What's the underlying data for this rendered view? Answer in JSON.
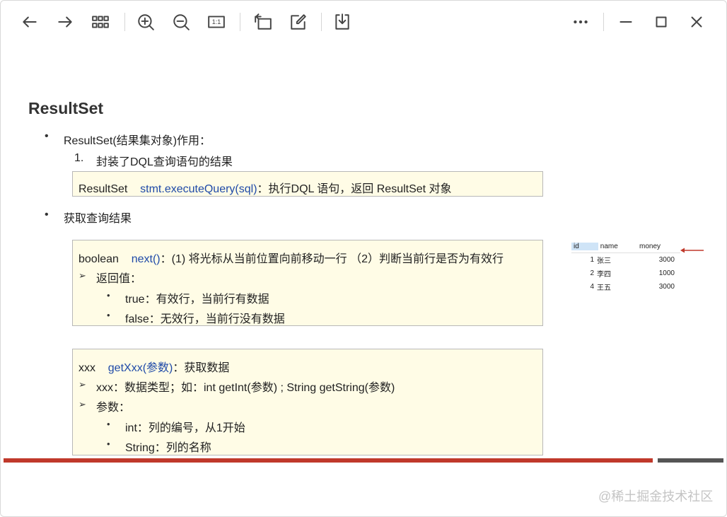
{
  "toolbar": {
    "icons": [
      "back-arrow-icon",
      "forward-arrow-icon",
      "grid-icon",
      "zoom-in-icon",
      "zoom-out-icon",
      "actual-size-icon",
      "rotate-icon",
      "edit-icon",
      "download-icon",
      "more-icon",
      "minimize-icon",
      "maximize-icon",
      "close-icon"
    ],
    "actual_size_label": "1:1"
  },
  "slide": {
    "title": "ResultSet",
    "bullet1": "ResultSet(结果集对象)作用：",
    "item1_num": "1.",
    "item1_text": "封装了DQL查询语句的结果",
    "box1": {
      "type_word": "ResultSet",
      "method": "stmt.executeQuery(sql)",
      "desc": "：执行DQL 语句，返回 ResultSet 对象"
    },
    "bullet2": "获取查询结果",
    "box2": {
      "type_word": "boolean",
      "method": "next()",
      "desc": "：(1) 将光标从当前位置向前移动一行 （2）判断当前行是否为有效行",
      "return_label": "返回值：",
      "true_line": "true：有效行，当前行有数据",
      "false_line": "false：无效行，当前行没有数据"
    },
    "box3": {
      "type_word": "xxx",
      "method": "getXxx(参数)",
      "desc": "：获取数据",
      "line1": "xxx：数据类型；如：int getInt(参数) ; String getString(参数)",
      "line2": "参数：",
      "int_line": "int：列的编号，从1开始",
      "string_line": "String：列的名称"
    },
    "table": {
      "headers": [
        "id",
        "name",
        "money"
      ],
      "rows": [
        {
          "id": "1",
          "name": "张三",
          "money": "3000"
        },
        {
          "id": "2",
          "name": "李四",
          "money": "1000"
        },
        {
          "id": "4",
          "name": "王五",
          "money": "3000"
        }
      ]
    }
  },
  "colors": {
    "accent_red": "#c0392b",
    "bar_grey": "#555555",
    "box_bg": "#fffce6",
    "method_blue": "#1f4aa8"
  },
  "watermark": "@稀土掘金技术社区"
}
